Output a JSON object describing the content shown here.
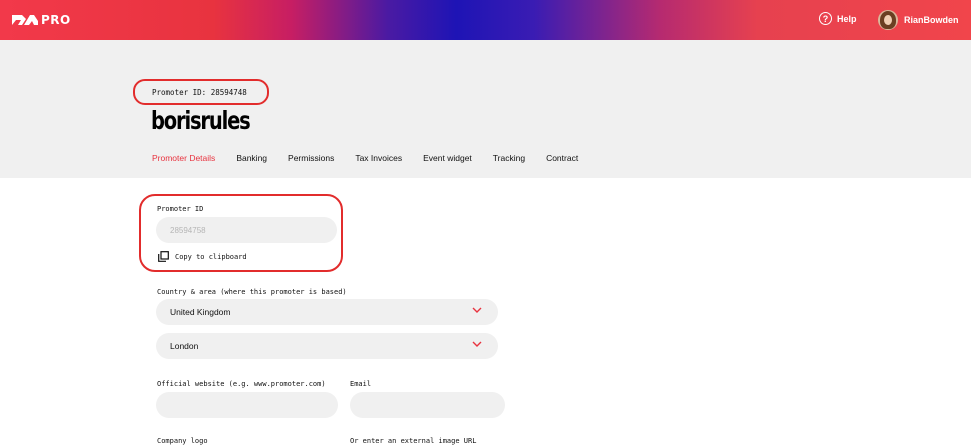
{
  "topbar": {
    "logo_text": "PRO",
    "help_label": "Help",
    "user_name": "RianBowden"
  },
  "header": {
    "promoter_id_line": "Promoter ID: 28594748",
    "title": "borisrules",
    "tabs": [
      {
        "label": "Promoter Details",
        "active": true
      },
      {
        "label": "Banking",
        "active": false
      },
      {
        "label": "Permissions",
        "active": false
      },
      {
        "label": "Tax Invoices",
        "active": false
      },
      {
        "label": "Event widget",
        "active": false
      },
      {
        "label": "Tracking",
        "active": false
      },
      {
        "label": "Contract",
        "active": false
      }
    ]
  },
  "form": {
    "promoter_id_label": "Promoter ID",
    "promoter_id_value": "28594758",
    "copy_label": "Copy to clipboard",
    "country_label": "Country & area (where this promoter is based)",
    "country_value": "United Kingdom",
    "city_value": "London",
    "website_label": "Official website (e.g. www.promoter.com)",
    "website_value": "",
    "email_label": "Email",
    "email_value": "",
    "logo_label": "Company logo",
    "external_url_label": "Or enter an external image URL"
  },
  "colors": {
    "accent": "#e8333f",
    "annotation": "#e22c2c",
    "field_bg": "#f0f0f0"
  }
}
